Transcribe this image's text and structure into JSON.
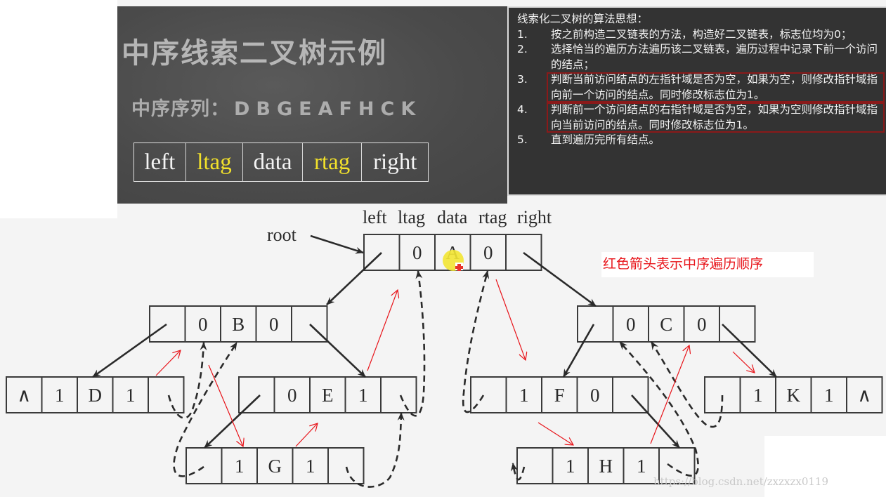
{
  "chalkboard": {
    "title": "中序线索二叉树示例",
    "sequence_label": "中序序列：",
    "sequence_letters": "DBGEAFHCK",
    "fields": [
      {
        "label": "left",
        "highlight": false
      },
      {
        "label": "ltag",
        "highlight": true
      },
      {
        "label": "data",
        "highlight": false
      },
      {
        "label": "rtag",
        "highlight": true
      },
      {
        "label": "right",
        "highlight": false
      }
    ],
    "highlight_color": "#f2e12b"
  },
  "algorithm": {
    "title": "线索化二叉树的算法思想：",
    "steps": [
      {
        "num": "1.",
        "text": "按之前构造二叉链表的方法，构造好二叉链表，标志位均为0；",
        "boxed": false
      },
      {
        "num": "2.",
        "text": "选择恰当的遍历方法遍历该二叉链表，遍历过程中记录下前一个访问的结点；",
        "boxed": false
      },
      {
        "num": "3.",
        "text": "判断当前访问结点的左指针域是否为空，如果为空，则修改指针域指向前一个访问的结点。同时修改标志位为1。",
        "boxed": true
      },
      {
        "num": "4.",
        "text": "判断前一个访问结点的右指针域是否为空，如果为空则修改指针域指向当前访问的结点。同时修改标志位为1。",
        "boxed": true
      },
      {
        "num": "5.",
        "text": "直到遍历完所有结点。",
        "boxed": false
      }
    ],
    "box_color": "#8a1a1a"
  },
  "tree": {
    "header_labels": [
      "left",
      "ltag",
      "data",
      "rtag",
      "right"
    ],
    "root_label": "root",
    "null_symbol": "∧",
    "nodes": [
      {
        "id": "A",
        "cells": [
          "",
          "0",
          "A",
          "0",
          ""
        ]
      },
      {
        "id": "B",
        "cells": [
          "",
          "0",
          "B",
          "0",
          ""
        ]
      },
      {
        "id": "C",
        "cells": [
          "",
          "0",
          "C",
          "0",
          ""
        ]
      },
      {
        "id": "D",
        "cells": [
          "∧",
          "1",
          "D",
          "1",
          ""
        ]
      },
      {
        "id": "E",
        "cells": [
          "",
          "0",
          "E",
          "1",
          ""
        ]
      },
      {
        "id": "F",
        "cells": [
          "",
          "1",
          "F",
          "0",
          ""
        ]
      },
      {
        "id": "K",
        "cells": [
          "",
          "1",
          "K",
          "1",
          "∧"
        ]
      },
      {
        "id": "G",
        "cells": [
          "",
          "1",
          "G",
          "1",
          ""
        ]
      },
      {
        "id": "H",
        "cells": [
          "",
          "1",
          "H",
          "1",
          ""
        ]
      }
    ],
    "child_links": [
      [
        "A",
        "B"
      ],
      [
        "A",
        "C"
      ],
      [
        "B",
        "D"
      ],
      [
        "B",
        "E"
      ],
      [
        "C",
        "F"
      ],
      [
        "C",
        "K"
      ],
      [
        "E",
        "G"
      ],
      [
        "F",
        "H"
      ]
    ],
    "inorder": [
      "D",
      "B",
      "G",
      "E",
      "A",
      "F",
      "H",
      "C",
      "K"
    ],
    "note": "红色箭头表示中序遍历顺序",
    "note_color": "#e8141a",
    "line_color": "#2a2a2a"
  },
  "watermark": "https://blog.csdn.net/zxzxzx0119"
}
